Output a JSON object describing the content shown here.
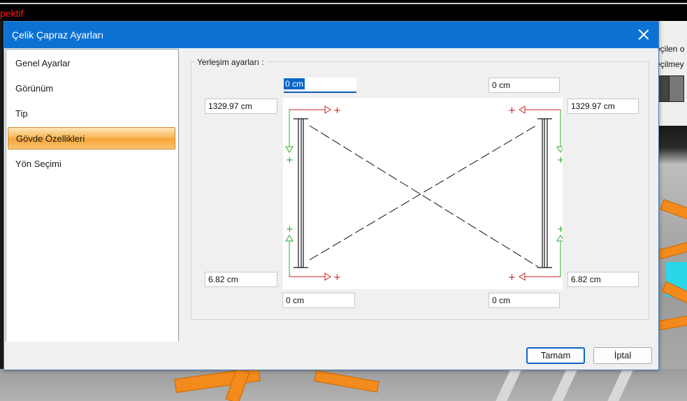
{
  "background": {
    "app_title": "pektif",
    "right_text_1": "eçilen o",
    "right_text_2": "eçilmey"
  },
  "dialog": {
    "title": "Çelik Çapraz Ayarları",
    "nav": [
      {
        "label": "Genel Ayarlar"
      },
      {
        "label": "Görünüm"
      },
      {
        "label": "Tip"
      },
      {
        "label": "Gövde Özellikleri",
        "selected": true
      },
      {
        "label": "Yön Seçimi"
      }
    ],
    "group_label": "Yerleşim ayarları :",
    "fields": {
      "top_left": "0 cm",
      "top_right": "0 cm",
      "left_upper": "1329.97 cm",
      "right_upper": "1329.97 cm",
      "left_lower": "6.82 cm",
      "right_lower": "6.82 cm",
      "bottom_left": "0 cm",
      "bottom_right": "0 cm"
    },
    "buttons": {
      "ok": "Tamam",
      "cancel": "İptal"
    }
  },
  "colors": {
    "titlebar": "#0b72d4",
    "selected_nav": "#f6a637",
    "arrow_red": "#c81e1e",
    "arrow_green": "#2eaa2e"
  }
}
